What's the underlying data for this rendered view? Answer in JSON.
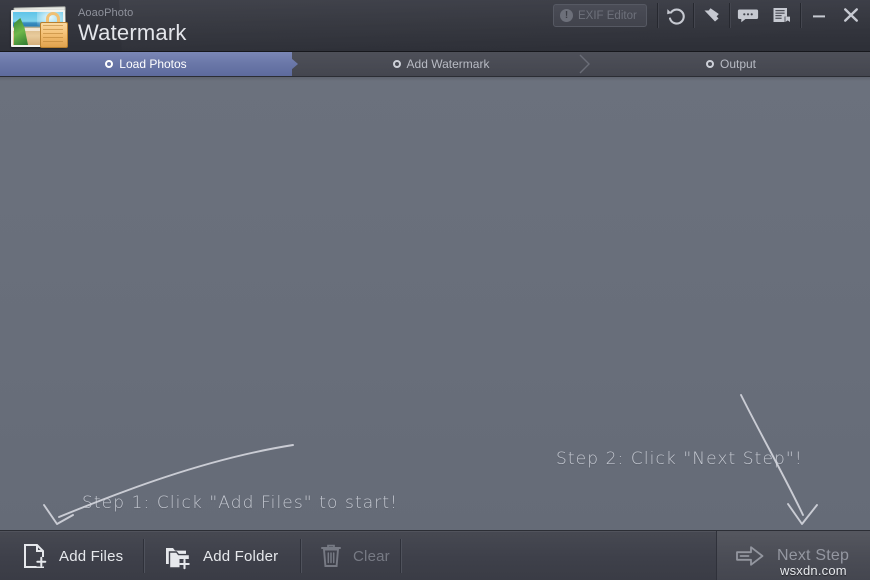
{
  "window": {
    "brand_small": "AoaoPhoto",
    "brand_big": "Watermark",
    "logo_icon": "photo-lock-logo-icon"
  },
  "titlebar": {
    "exif_button": {
      "label": "EXIF Editor",
      "warn_glyph": "!",
      "enabled": false
    },
    "tools": [
      {
        "name": "undo-icon",
        "title": "Undo"
      },
      {
        "name": "hammer-icon",
        "title": "Tools"
      },
      {
        "name": "chat-bubble-icon",
        "title": "Feedback"
      },
      {
        "name": "register-document-icon",
        "title": "Register"
      }
    ],
    "window_controls": [
      {
        "name": "minimize-icon",
        "glyph": "—"
      },
      {
        "name": "close-icon",
        "glyph": "✕"
      }
    ]
  },
  "steps": [
    {
      "label": "Load Photos",
      "active": true
    },
    {
      "label": "Add Watermark",
      "active": false
    },
    {
      "label": "Output",
      "active": false
    }
  ],
  "main": {
    "hint_1": "Step 1: Click \"Add Files\" to start!",
    "hint_2": "Step 2: Click \"Next Step\"!",
    "arrow_1_name": "curved-arrow-to-add-files",
    "arrow_2_name": "curved-arrow-to-next-step",
    "file_list_empty": true
  },
  "bottombar": {
    "buttons": [
      {
        "label": "Add Files",
        "icon": "file-plus-icon",
        "enabled": true
      },
      {
        "label": "Add Folder",
        "icon": "folder-plus-icon",
        "enabled": true
      },
      {
        "label": "Clear",
        "icon": "trash-icon",
        "enabled": false
      }
    ],
    "next_step": {
      "label": "Next Step",
      "icon": "arrow-right-icon",
      "enabled": true
    }
  },
  "overlay": {
    "site_watermark": "wsxdn.com"
  },
  "colors": {
    "titlebar": "#34363e",
    "step_active": "#6a77a8",
    "canvas": "#686e7a",
    "bottombar": "#3e404a",
    "text_primary": "#e6e8ec",
    "text_disabled": "#777a84"
  }
}
